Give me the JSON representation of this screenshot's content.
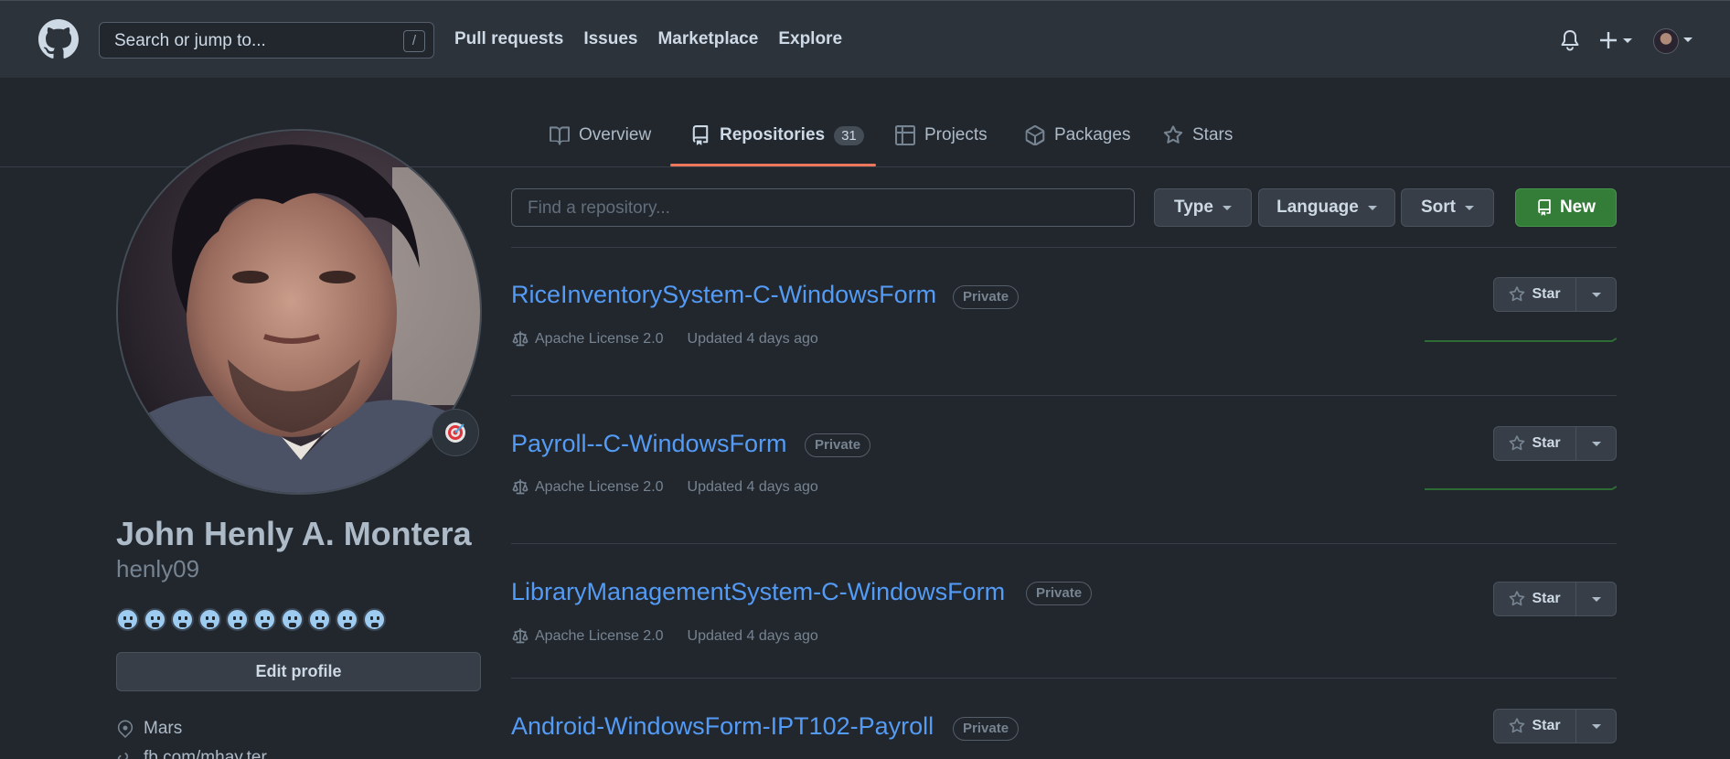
{
  "header": {
    "search_placeholder": "Search or jump to...",
    "search_shortcut": "/",
    "nav": [
      "Pull requests",
      "Issues",
      "Marketplace",
      "Explore"
    ]
  },
  "tabs": [
    {
      "label": "Overview",
      "icon": "book-icon"
    },
    {
      "label": "Repositories",
      "icon": "repo-icon",
      "count": "31",
      "active": true
    },
    {
      "label": "Projects",
      "icon": "table-icon"
    },
    {
      "label": "Packages",
      "icon": "package-icon"
    },
    {
      "label": "Stars",
      "icon": "star-icon"
    }
  ],
  "profile": {
    "full_name": "John Henly A. Montera",
    "username": "henly09",
    "status_emoji": "dart",
    "emoji_count": 10,
    "edit_label": "Edit profile",
    "location": "Mars",
    "website": "fb.com/mhay.ter"
  },
  "toolbar": {
    "find_placeholder": "Find a repository...",
    "type_label": "Type",
    "language_label": "Language",
    "sort_label": "Sort",
    "new_label": "New"
  },
  "repos": [
    {
      "name": "RiceInventorySystem-C-WindowsForm",
      "visibility": "Private",
      "license": "Apache License 2.0",
      "updated": "Updated 4 days ago",
      "star_label": "Star"
    },
    {
      "name": "Payroll--C-WindowsForm",
      "visibility": "Private",
      "license": "Apache License 2.0",
      "updated": "Updated 4 days ago",
      "star_label": "Star"
    },
    {
      "name": "LibraryManagementSystem-C-WindowsForm",
      "visibility": "Private",
      "license": "Apache License 2.0",
      "updated": "Updated 4 days ago",
      "star_label": "Star"
    },
    {
      "name": "Android-WindowsForm-IPT102-Payroll",
      "visibility": "Private",
      "star_label": "Star"
    }
  ],
  "colors": {
    "background": "#22272e",
    "header": "#2d333b",
    "link": "#539bf5",
    "tab_active_underline": "#ec775c",
    "new_button": "#347d39"
  }
}
